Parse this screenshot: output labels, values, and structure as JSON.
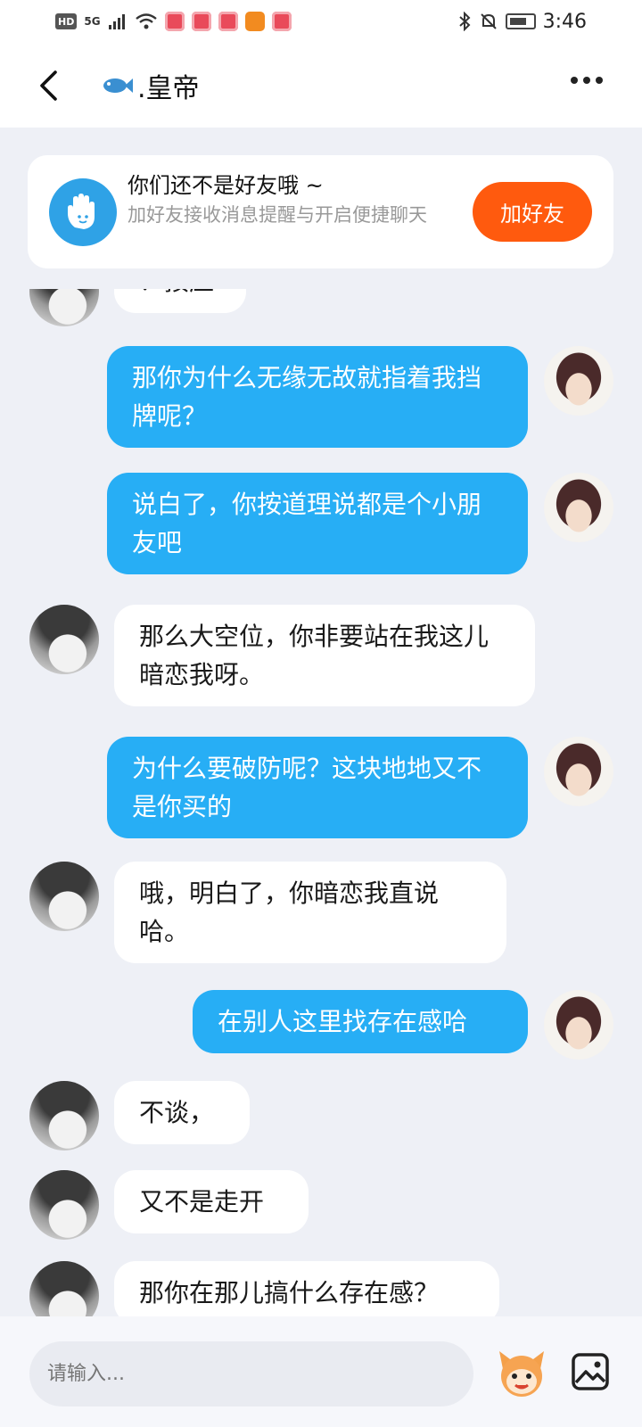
{
  "status_bar": {
    "network_label": "HD",
    "network_gen": "5G",
    "time": "3:46"
  },
  "header": {
    "title": ".皇帝",
    "back_icon": "chevron-left-icon",
    "more_icon": "more-dots-icon"
  },
  "friend_banner": {
    "title": "你们还不是好友哦 ~",
    "subtitle": "加好友接收消息提醒与开启便捷聊天",
    "button_label": "加好友",
    "accent_color": "#ff5a0e"
  },
  "messages": [
    {
      "side": "in",
      "text": "？按应"
    },
    {
      "side": "out",
      "text": "那你为什么无缘无故就指着我挡牌呢？"
    },
    {
      "side": "out",
      "text": "说白了，你按道理说都是个小朋友吧"
    },
    {
      "side": "in",
      "text": "那么大空位，你非要站在我这儿   暗恋我呀。"
    },
    {
      "side": "out",
      "text": "为什么要破防呢？这块地地又不是你买的"
    },
    {
      "side": "in",
      "text": "哦，明白了，你暗恋我直说哈。"
    },
    {
      "side": "out",
      "text": "在别人这里找存在感哈"
    },
    {
      "side": "in",
      "text": "不谈，"
    },
    {
      "side": "in",
      "text": "又不是走开"
    },
    {
      "side": "in",
      "text": "那你在那儿搞什么存在感？"
    }
  ],
  "input_bar": {
    "placeholder": "请输入...",
    "emoji_icon": "emoji-mascot-icon",
    "image_icon": "image-icon"
  },
  "colors": {
    "outgoing_bubble": "#27aef5",
    "incoming_bubble": "#ffffff",
    "background": "#eef0f6"
  }
}
